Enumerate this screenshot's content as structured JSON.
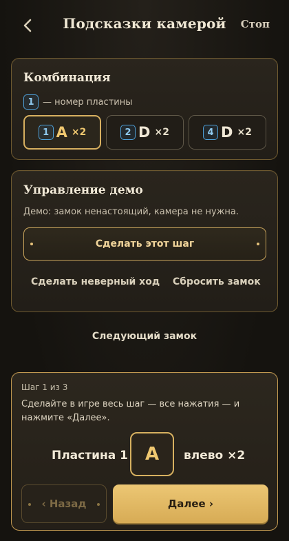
{
  "header": {
    "title": "Подсказки камерой",
    "stop_label": "Стоп"
  },
  "combination": {
    "title": "Комбинация",
    "legend_number": "1",
    "legend_text": "— номер пластины",
    "items": [
      {
        "plate": "1",
        "letter": "A",
        "count": "×2",
        "active": true
      },
      {
        "plate": "2",
        "letter": "D",
        "count": "×2",
        "active": false
      },
      {
        "plate": "4",
        "letter": "D",
        "count": "×2",
        "active": false
      }
    ]
  },
  "demo": {
    "title": "Управление демо",
    "description": "Демо: замок ненастоящий, камера не нужна.",
    "do_step_label": "Сделать этот шаг",
    "wrong_move_label": "Сделать неверный ход",
    "reset_label": "Сбросить замок"
  },
  "next_lock_label": "Следующий замок",
  "step": {
    "counter": "Шаг 1 из 3",
    "instruction": "Сделайте в игре весь шаг — все нажатия — и нажмите «Далее».",
    "plate_label": "Пластина 1",
    "key": "A",
    "direction": "влево ×2",
    "back_label": "‹ Назад",
    "next_label": "Далее ›"
  }
}
